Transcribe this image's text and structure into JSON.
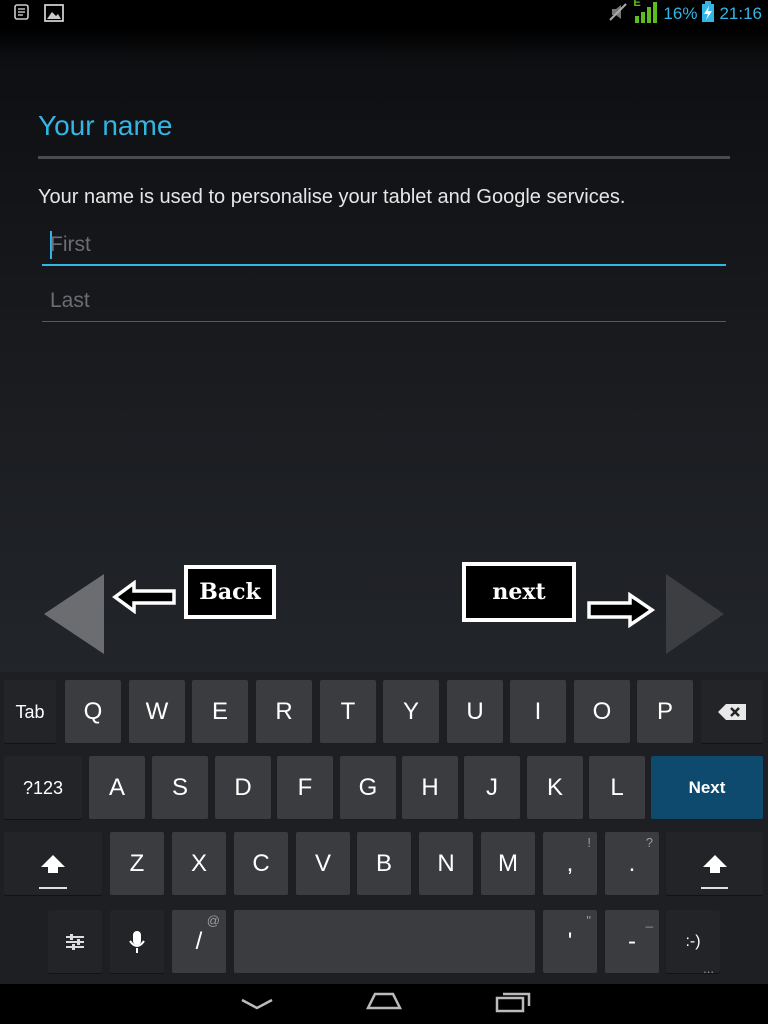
{
  "status_bar": {
    "battery_percent": "16%",
    "time": "21:16",
    "network_type": "E",
    "icons": [
      "sd-card-icon",
      "image-icon",
      "mute-icon",
      "signal-icon",
      "battery-charging-icon"
    ]
  },
  "setup": {
    "title": "Your name",
    "description": "Your name is used to personalise your tablet and Google services.",
    "first_placeholder": "First",
    "last_placeholder": "Last",
    "accent_color": "#33b5e5"
  },
  "navigation": {
    "back_annotation": "Back",
    "next_annotation": "next"
  },
  "keyboard": {
    "row1": [
      "Q",
      "W",
      "E",
      "R",
      "T",
      "Y",
      "U",
      "I",
      "O",
      "P"
    ],
    "row2": [
      "A",
      "S",
      "D",
      "F",
      "G",
      "H",
      "J",
      "K",
      "L"
    ],
    "row3": [
      "Z",
      "X",
      "C",
      "V",
      "B",
      "N",
      "M"
    ],
    "tab_label": "Tab",
    "sym_label": "?123",
    "next_label": "Next",
    "comma": ",",
    "comma_hint": "!",
    "period": ".",
    "period_hint": "?",
    "slash": "/",
    "slash_hint": "@",
    "apostrophe": "'",
    "apostrophe_hint": "\"",
    "dash": "-",
    "dash_hint": "_",
    "smiley": ":-)",
    "smiley_hint": "..."
  }
}
